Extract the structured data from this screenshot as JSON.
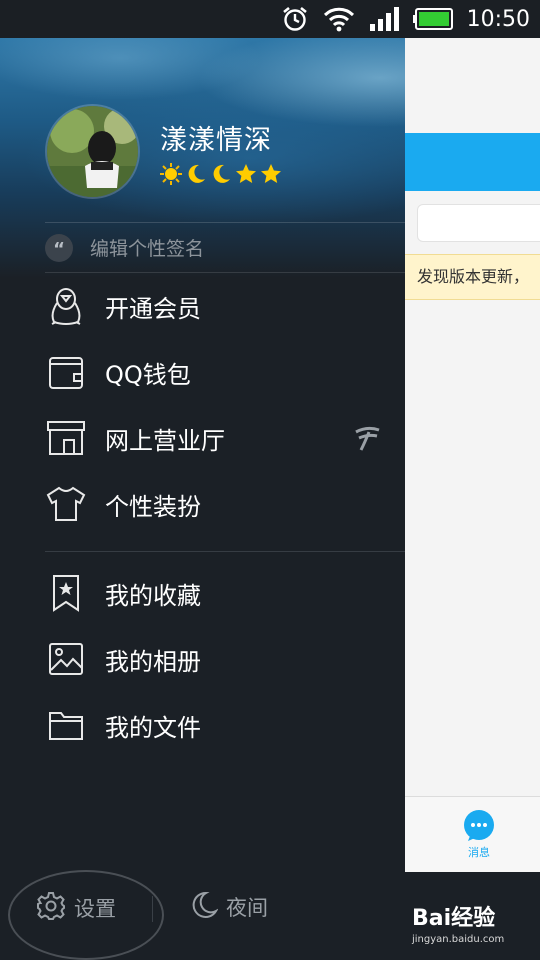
{
  "status_bar": {
    "time": "10:50",
    "alarm_icon": "alarm-clock-icon",
    "wifi_icon": "wifi-icon",
    "signal_icon": "signal-bars-icon",
    "battery_icon": "battery-icon"
  },
  "profile": {
    "nickname": "漾漾情深",
    "level_icons": [
      "sun-icon",
      "moon-icon",
      "moon-icon",
      "star-icon",
      "star-icon"
    ]
  },
  "signature": {
    "quote_mark": "“",
    "placeholder": "编辑个性签名"
  },
  "menu": {
    "group1": [
      {
        "label": "开通会员",
        "icon": "penguin-icon"
      },
      {
        "label": "QQ钱包",
        "icon": "wallet-icon"
      },
      {
        "label": "网上营业厅",
        "icon": "storefront-icon",
        "badge_icon": "china-telecom-icon"
      },
      {
        "label": "个性装扮",
        "icon": "tshirt-icon"
      }
    ],
    "group2": [
      {
        "label": "我的收藏",
        "icon": "bookmark-star-icon"
      },
      {
        "label": "我的相册",
        "icon": "photo-icon"
      },
      {
        "label": "我的文件",
        "icon": "folder-icon"
      }
    ]
  },
  "bottom": {
    "settings_label": "设置",
    "night_label": "夜间"
  },
  "main_peek": {
    "banner_text": "发现版本更新，",
    "tab_message_label": "消息"
  },
  "watermark": {
    "logo_text": "Bai经验",
    "url": "jingyan.baidu.com"
  },
  "colors": {
    "accent": "#1aaaf0",
    "drawer_bg": "#1b2026",
    "banner_bg": "#fff4cc"
  }
}
